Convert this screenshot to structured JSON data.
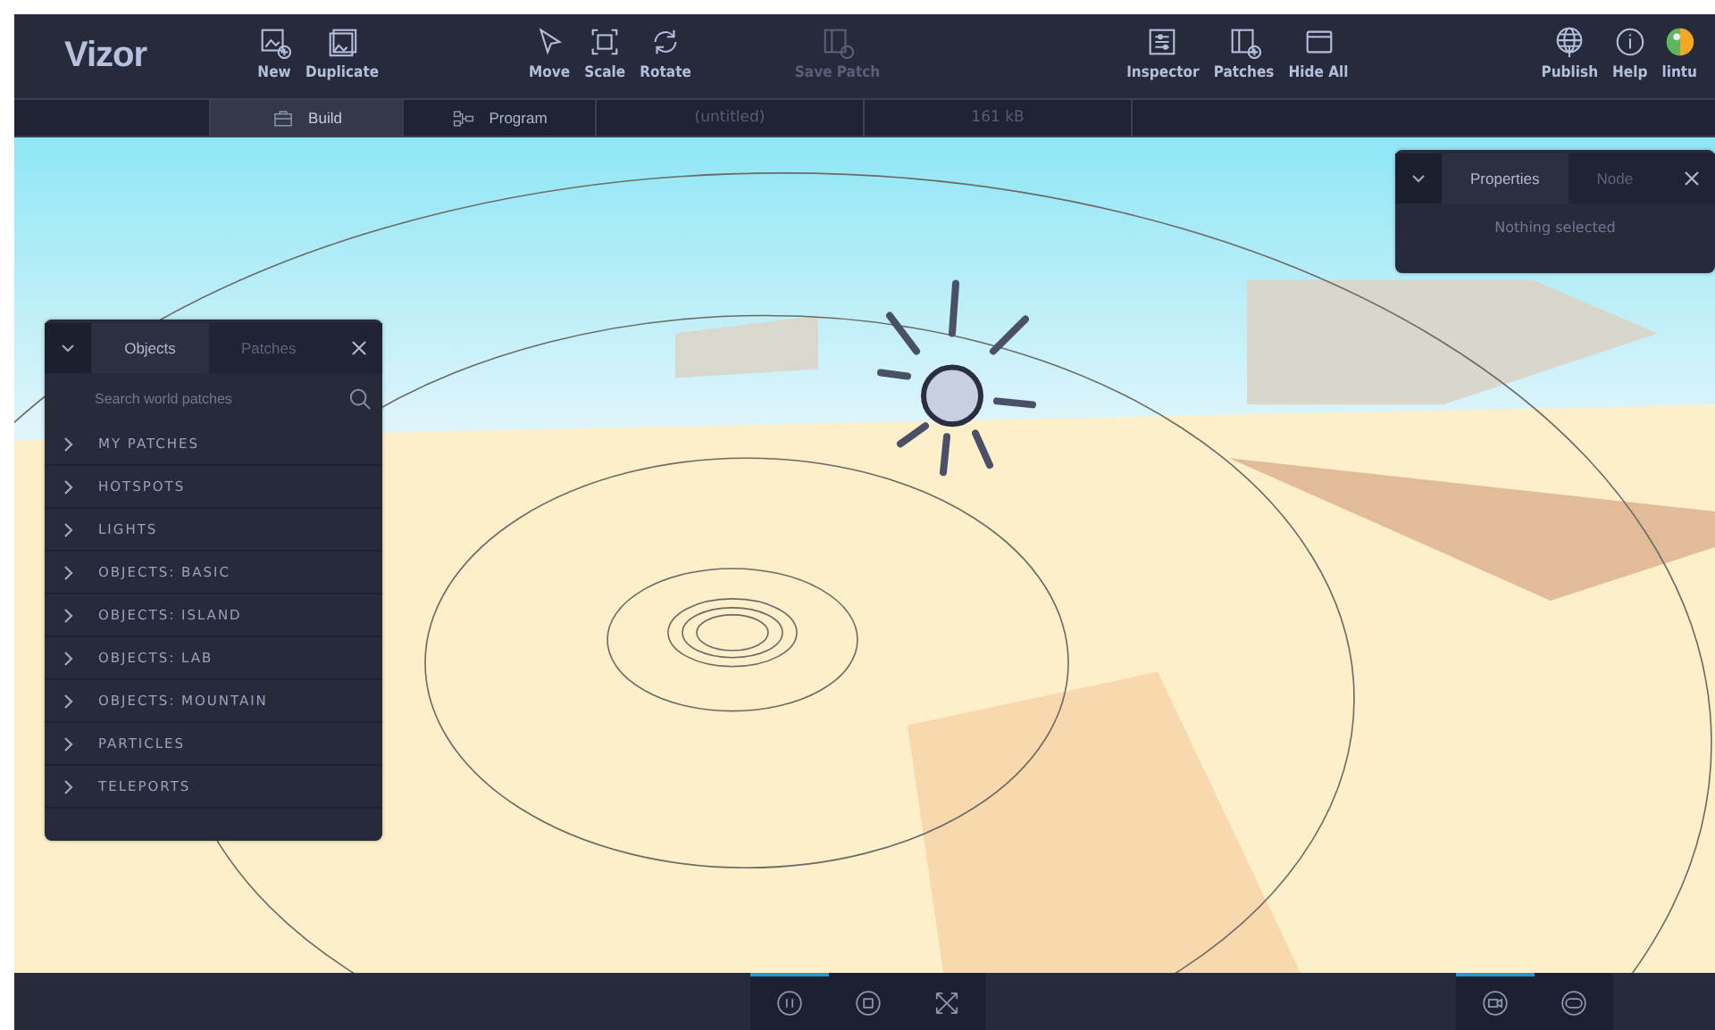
{
  "app": {
    "logo": "Vizor"
  },
  "toolbar": {
    "groups": [
      {
        "items": [
          {
            "label": "New",
            "kind": "image-plus",
            "disabled": false
          },
          {
            "label": "Duplicate",
            "kind": "images",
            "disabled": false
          }
        ]
      },
      {
        "items": [
          {
            "label": "Move",
            "kind": "cursor",
            "disabled": false
          },
          {
            "label": "Scale",
            "kind": "scale",
            "disabled": false
          },
          {
            "label": "Rotate",
            "kind": "rotate",
            "disabled": false
          }
        ]
      },
      {
        "items": [
          {
            "label": "Save Patch",
            "kind": "patch-save",
            "disabled": true
          }
        ]
      },
      {
        "items": [
          {
            "label": "Inspector",
            "kind": "sliders",
            "disabled": false
          },
          {
            "label": "Patches",
            "kind": "patch-plus",
            "disabled": false
          },
          {
            "label": "Hide All",
            "kind": "windows",
            "disabled": false
          }
        ]
      },
      {
        "items": [
          {
            "label": "Publish",
            "kind": "globe",
            "disabled": false
          },
          {
            "label": "Help",
            "kind": "info",
            "disabled": false
          },
          {
            "label": "lintu",
            "kind": "avatar",
            "disabled": false
          }
        ]
      }
    ]
  },
  "mode_tabs": [
    {
      "label": "Build",
      "kind": "briefcase",
      "selected": true
    },
    {
      "label": "Program",
      "kind": "nodes",
      "selected": false
    }
  ],
  "document": {
    "title": "(untitled)",
    "size": "161 kB"
  },
  "objects_panel": {
    "tabs": [
      {
        "label": "Objects",
        "selected": true
      },
      {
        "label": "Patches",
        "selected": false
      }
    ],
    "search": {
      "placeholder": "Search world patches"
    },
    "categories": [
      {
        "label": "MY PATCHES"
      },
      {
        "label": "HOTSPOTS"
      },
      {
        "label": "LIGHTS"
      },
      {
        "label": "OBJECTS: BASIC"
      },
      {
        "label": "OBJECTS: ISLAND"
      },
      {
        "label": "OBJECTS: LAB"
      },
      {
        "label": "OBJECTS: MOUNTAIN"
      },
      {
        "label": "PARTICLES"
      },
      {
        "label": "TELEPORTS"
      }
    ]
  },
  "properties_panel": {
    "tabs": [
      {
        "label": "Properties",
        "selected": true
      },
      {
        "label": "Node",
        "selected": false
      }
    ],
    "message": "Nothing selected"
  },
  "bottom_bar": {
    "left": [
      {
        "kind": "pause",
        "active": true
      },
      {
        "kind": "stop",
        "active": false
      },
      {
        "kind": "fullscreen",
        "active": false
      }
    ],
    "right": [
      {
        "kind": "camera",
        "active": true
      },
      {
        "kind": "headset",
        "active": false
      }
    ]
  }
}
